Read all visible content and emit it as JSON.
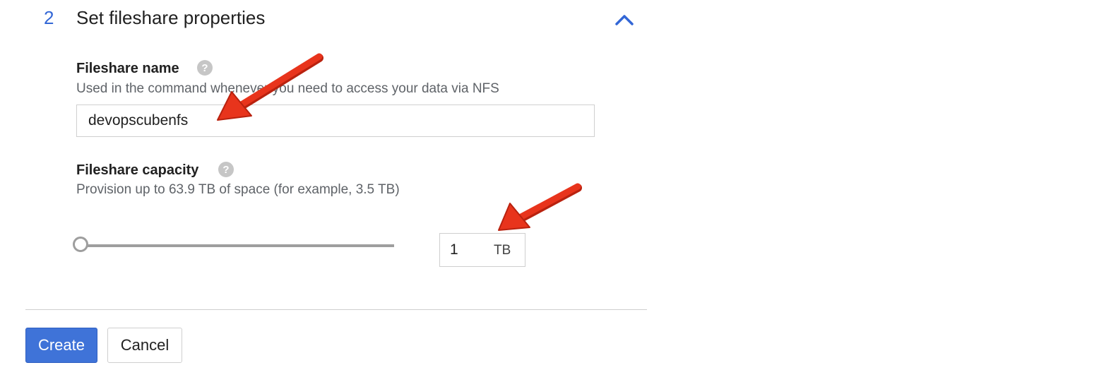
{
  "step": {
    "number": "2",
    "title": "Set fileshare properties",
    "collapse_icon": "chevron-up-icon"
  },
  "fileshare_name": {
    "label": "Fileshare name",
    "help_icon": "help-icon",
    "help_glyph": "?",
    "hint": "Used in the command whenever you need to access your data via NFS",
    "value": "devopscubenfs"
  },
  "fileshare_capacity": {
    "label": "Fileshare capacity",
    "help_icon": "help-icon",
    "help_glyph": "?",
    "hint": "Provision up to 63.9 TB of space (for example, 3.5 TB)",
    "value": "1",
    "unit": "TB",
    "slider_level": 0
  },
  "actions": {
    "create_label": "Create",
    "cancel_label": "Cancel"
  },
  "colors": {
    "accent": "#3367d6",
    "primary_button": "#3f73d8",
    "annotation_arrow": "#e8341c"
  }
}
